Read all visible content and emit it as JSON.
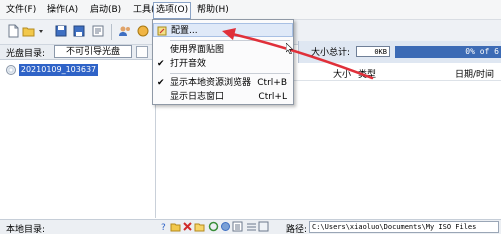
{
  "menubar": {
    "items": [
      {
        "label": "文件(F)"
      },
      {
        "label": "操作(A)"
      },
      {
        "label": "启动(B)"
      },
      {
        "label": "工具(T)"
      },
      {
        "label": "选项(O)"
      },
      {
        "label": "帮助(H)"
      }
    ]
  },
  "toolbar": {
    "size_label": "大小总计:",
    "size_value": "0KB",
    "size_bar_text": "0% of 6"
  },
  "disc": {
    "label": "光盘目录:",
    "select_value": "不可引导光盘"
  },
  "tree": {
    "node_label": "20210109_103637"
  },
  "list": {
    "columns": [
      "大小",
      "类型",
      "日期/时间"
    ]
  },
  "options_menu": {
    "items": [
      {
        "label": "配置...",
        "accelerator": "",
        "checked": false
      },
      {
        "label": "使用界面贴图",
        "accelerator": "",
        "checked": false
      },
      {
        "label": "打开音效",
        "accelerator": "",
        "checked": true
      },
      {
        "label": "显示本地资源浏览器",
        "accelerator": "Ctrl+B",
        "checked": true
      },
      {
        "label": "显示日志窗口",
        "accelerator": "Ctrl+L",
        "checked": false
      }
    ]
  },
  "bottombar": {
    "local_label": "本地目录:",
    "path_label": "路径:",
    "path_value": "C:\\Users\\xiaoluo\\Documents\\My ISO Files"
  },
  "colors": {
    "accent": "#2f63c7",
    "annotation_arrow": "#e0303a"
  }
}
